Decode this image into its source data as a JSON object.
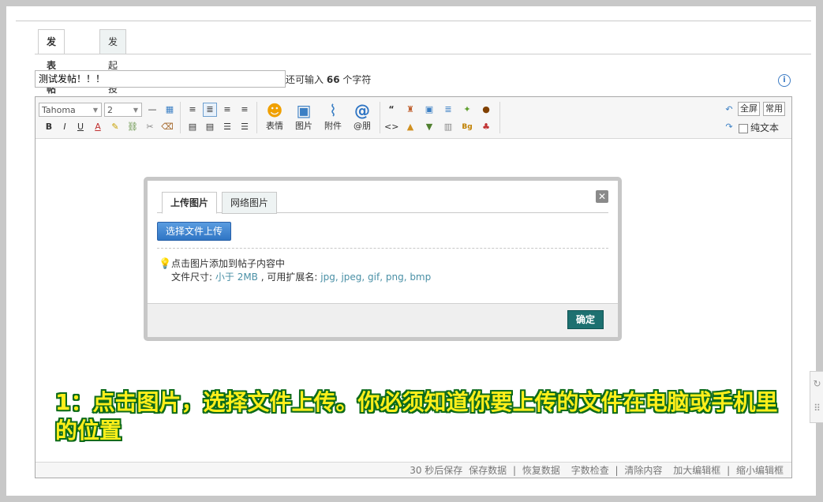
{
  "tabs": {
    "post": "发表帖子",
    "poll": "发起投票"
  },
  "subject": {
    "value": "测试发帖！！！"
  },
  "remaining": {
    "prefix": "还可输入",
    "count": "66",
    "suffix": "个字符"
  },
  "toolbar": {
    "font_family": "Tahoma",
    "font_size": "2",
    "big_buttons": {
      "emoji": "表情",
      "image": "图片",
      "attachment": "附件",
      "mention": "@朋"
    },
    "fullscreen": "全屏",
    "common": "常用",
    "plain_text": "纯文本",
    "format_letters": {
      "bold": "B",
      "italic": "I",
      "underline": "U",
      "color": "A"
    }
  },
  "dialog": {
    "tab_upload": "上传图片",
    "tab_network": "网络图片",
    "upload_button": "选择文件上传",
    "tip_line1": "点击图片添加到帖子内容中",
    "size_label": "文件尺寸:",
    "size_value": "小于 2MB",
    "ext_label": ", 可用扩展名:",
    "ext_value": "jpg, jpeg, gif, png, bmp",
    "ok": "确定"
  },
  "footer": {
    "autosave": "30 秒后保存",
    "save": "保存数据",
    "restore": "恢复数据",
    "check": "字数检查",
    "clear": "清除内容",
    "enlarge": "加大编辑框",
    "shrink": "缩小编辑框"
  },
  "callout": {
    "text": "1：点击图片，选择文件上传。你必须知道你要上传的文件在电脑或手机里的位置"
  }
}
